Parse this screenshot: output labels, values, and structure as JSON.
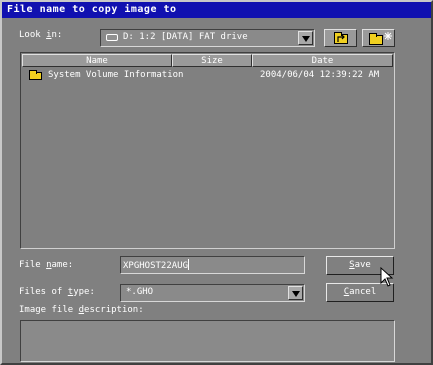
{
  "dialog": {
    "title": "File name to copy image to"
  },
  "look_in": {
    "label_pre": "Look ",
    "label_u": "i",
    "label_post": "n:",
    "value": "D: 1:2 [DATA] FAT drive",
    "icon": "hard-drive-icon"
  },
  "toolbar": {
    "up_icon": "up-folder-icon",
    "new_icon": "new-folder-icon"
  },
  "list": {
    "columns": [
      "Name",
      "Size",
      "Date"
    ],
    "rows": [
      {
        "name": "System Volume Information",
        "size": "",
        "date": "2004/06/04 12:39:22 AM",
        "icon": "folder-icon"
      }
    ]
  },
  "filename": {
    "label_pre": "File ",
    "label_u": "n",
    "label_post": "ame:",
    "value": "XPGHOST22AUG"
  },
  "filetype": {
    "label_pre": "Files of ",
    "label_u": "t",
    "label_post": "ype:",
    "value": "*.GHO"
  },
  "description": {
    "label_pre": "Image file ",
    "label_u": "d",
    "label_post": "escription:",
    "value": ""
  },
  "buttons": {
    "save_u": "S",
    "save_rest": "ave",
    "cancel_u": "C",
    "cancel_rest": "ancel"
  },
  "colors": {
    "title_bar": "#1010b0",
    "dialog_bg": "#808080",
    "folder": "#f0d020"
  }
}
